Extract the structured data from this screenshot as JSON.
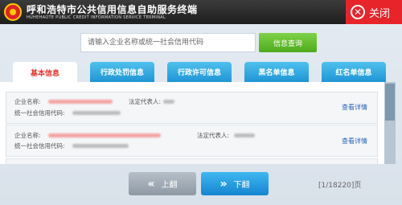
{
  "header": {
    "title": "呼和浩特市公共信用信息自助服务终端",
    "subtitle": "HUHEHAOTE PUBLIC CREDIT INFORMATION SERVICE TERMINAL",
    "close_label": "关闭"
  },
  "search": {
    "placeholder": "请输入企业名称或统一社会信用代码",
    "button_label": "信息查询"
  },
  "tabs": [
    {
      "label": "基本信息",
      "active": true
    },
    {
      "label": "行政处罚信息",
      "active": false
    },
    {
      "label": "行政许可信息",
      "active": false
    },
    {
      "label": "黑名单信息",
      "active": false
    },
    {
      "label": "红名单信息",
      "active": false
    }
  ],
  "records": [
    {
      "name_label": "企业名称:",
      "rep_label": "法定代表人:",
      "code_label": "统一社会信用代码:",
      "detail_label": "查看详情"
    },
    {
      "name_label": "企业名称:",
      "rep_label": "法定代表人:",
      "code_label": "统一社会信用代码:",
      "detail_label": "查看详情"
    }
  ],
  "pagination": {
    "prev_label": "上翻",
    "next_label": "下翻",
    "counter": "[1/18220]页"
  },
  "colors": {
    "accent_red": "#e5332a",
    "tab_blue": "#1f95d5",
    "search_green": "#4eaa1c",
    "close_red": "#e8242b"
  }
}
